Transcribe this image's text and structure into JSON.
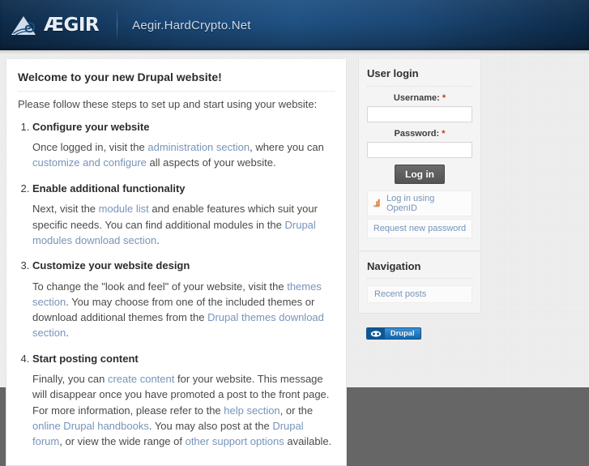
{
  "header": {
    "logo_icon": "aegir-wave-logo-icon",
    "logo_word": "ÆGIR",
    "site_name": "Aegir.HardCrypto.Net"
  },
  "main": {
    "title": "Welcome to your new Drupal website!",
    "intro": "Please follow these steps to set up and start using your website:",
    "steps": [
      {
        "title": "Configure your website",
        "paragraphs": [
          [
            {
              "t": "Once logged in, visit the ",
              "link": false
            },
            {
              "t": "administration section",
              "link": true
            },
            {
              "t": ", where you can ",
              "link": false
            },
            {
              "t": "customize and configure",
              "link": true
            },
            {
              "t": " all aspects of your website.",
              "link": false
            }
          ]
        ]
      },
      {
        "title": "Enable additional functionality",
        "paragraphs": [
          [
            {
              "t": "Next, visit the ",
              "link": false
            },
            {
              "t": "module list",
              "link": true
            },
            {
              "t": " and enable features which suit your specific needs. You can find additional modules in the ",
              "link": false
            },
            {
              "t": "Drupal modules download section",
              "link": true
            },
            {
              "t": ".",
              "link": false
            }
          ]
        ]
      },
      {
        "title": "Customize your website design",
        "paragraphs": [
          [
            {
              "t": "To change the \"look and feel\" of your website, visit the ",
              "link": false
            },
            {
              "t": "themes section",
              "link": true
            },
            {
              "t": ". You may choose from one of the included themes or download additional themes from the ",
              "link": false
            },
            {
              "t": "Drupal themes download section",
              "link": true
            },
            {
              "t": ".",
              "link": false
            }
          ]
        ]
      },
      {
        "title": "Start posting content",
        "paragraphs": [
          [
            {
              "t": "Finally, you can ",
              "link": false
            },
            {
              "t": "create content",
              "link": true
            },
            {
              "t": " for your website. This message will disappear once you have promoted a post to the front page.",
              "link": false
            }
          ],
          [
            {
              "t": "For more information, please refer to the ",
              "link": false
            },
            {
              "t": "help section",
              "link": true
            },
            {
              "t": ", or the ",
              "link": false
            },
            {
              "t": "online Drupal handbooks",
              "link": true
            },
            {
              "t": ". You may also post at the ",
              "link": false
            },
            {
              "t": "Drupal forum",
              "link": true
            },
            {
              "t": ", or view the wide range of ",
              "link": false
            },
            {
              "t": "other support options",
              "link": true
            },
            {
              "t": " available.",
              "link": false
            }
          ]
        ]
      }
    ]
  },
  "sidebar": {
    "login": {
      "title": "User login",
      "username_label": "Username:",
      "username_value": "",
      "password_label": "Password:",
      "password_value": "",
      "required_mark": "*",
      "submit_label": "Log in",
      "openid_label": "Log in using OpenID",
      "openid_icon": "openid-icon",
      "request_password_label": "Request new password"
    },
    "navigation": {
      "title": "Navigation",
      "items": [
        {
          "label": "Recent posts"
        }
      ]
    },
    "powered_by": {
      "badge_text": "Drupal",
      "badge_icon": "drupal-drop-icon"
    }
  },
  "colors": {
    "header_blue": "#1b4775",
    "link": "#7794b8",
    "required_red": "#d4301a",
    "button_gray": "#5c5c5c",
    "footer_gray": "#666666",
    "drupal_blue": "#1f79c4"
  }
}
